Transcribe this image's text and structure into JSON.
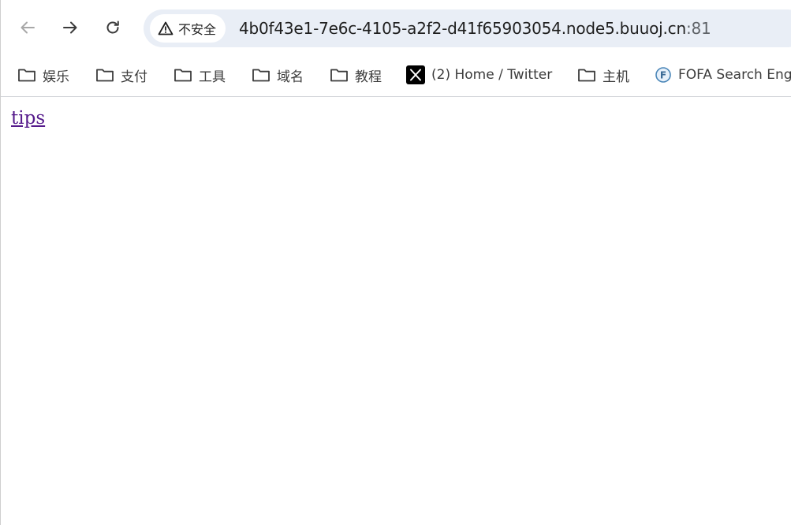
{
  "toolbar": {
    "back_icon": "back-arrow-icon",
    "forward_icon": "forward-arrow-icon",
    "reload_icon": "reload-icon"
  },
  "omnibox": {
    "security_icon": "warning-triangle-icon",
    "security_label": "不安全",
    "url_host": "4b0f43e1-7e6c-4105-a2f2-d41f65903054.node5.buuoj.cn",
    "url_port": ":81"
  },
  "bookmarks": {
    "items": [
      {
        "label": "娱乐",
        "icon": "folder-icon"
      },
      {
        "label": "支付",
        "icon": "folder-icon"
      },
      {
        "label": "工具",
        "icon": "folder-icon"
      },
      {
        "label": "域名",
        "icon": "folder-icon"
      },
      {
        "label": "教程",
        "icon": "folder-icon"
      },
      {
        "label": "(2) Home / Twitter",
        "icon": "x-logo-icon"
      },
      {
        "label": "主机",
        "icon": "folder-icon"
      },
      {
        "label": "FOFA Search Eng",
        "icon": "fofa-logo-icon"
      }
    ]
  },
  "page": {
    "link_text": "tips"
  },
  "colors": {
    "omnibox_bg": "#e9eef6",
    "visited_link": "#551a8b",
    "text": "#1f1f1f"
  }
}
